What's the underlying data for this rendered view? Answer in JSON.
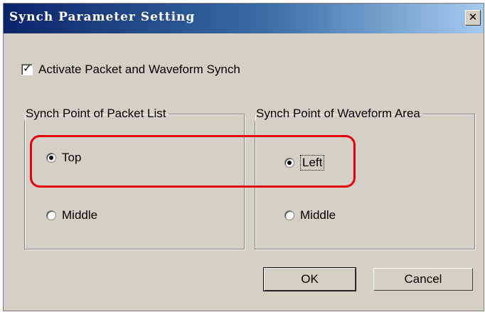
{
  "window": {
    "title": "Synch Parameter Setting",
    "close_glyph": "✕"
  },
  "activate": {
    "label": "Activate Packet and Waveform Synch",
    "checked": true
  },
  "packet_group": {
    "title": "Synch Point of Packet List",
    "options": [
      {
        "label": "Top",
        "selected": true
      },
      {
        "label": "Middle",
        "selected": false
      }
    ]
  },
  "waveform_group": {
    "title": "Synch Point of Waveform Area",
    "options": [
      {
        "label": "Left",
        "selected": true
      },
      {
        "label": "Middle",
        "selected": false
      }
    ]
  },
  "buttons": {
    "ok": "OK",
    "cancel": "Cancel"
  },
  "colors": {
    "highlight": "#e8000c",
    "titlebar_start": "#0a246a",
    "titlebar_end": "#a6caf0"
  }
}
